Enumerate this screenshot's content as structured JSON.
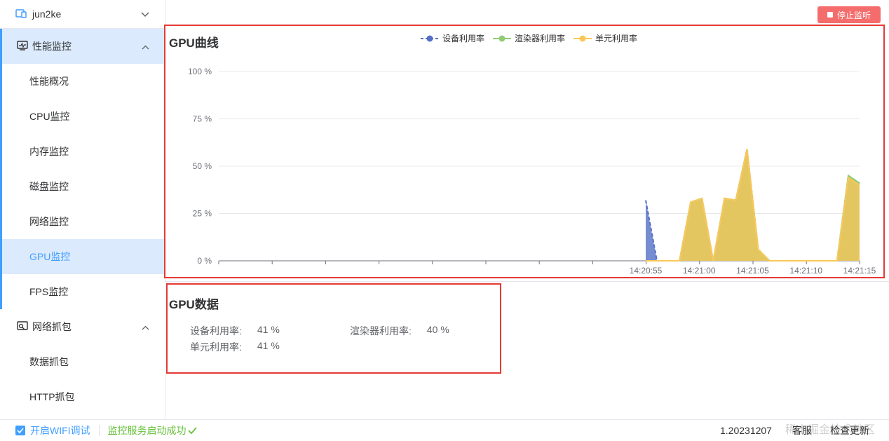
{
  "device": {
    "name": "jun2ke"
  },
  "sidebar": {
    "groups": [
      {
        "label": "性能监控",
        "items": [
          "性能概况",
          "CPU监控",
          "内存监控",
          "磁盘监控",
          "网络监控",
          "GPU监控",
          "FPS监控"
        ]
      },
      {
        "label": "网络抓包",
        "items": [
          "数据抓包",
          "HTTP抓包"
        ]
      }
    ],
    "active_item": "GPU监控"
  },
  "toolbar": {
    "stop_label": "停止监听"
  },
  "chart_panel": {
    "title": "GPU曲线"
  },
  "chart_data": {
    "type": "area",
    "title": "GPU曲线",
    "x_ticks": [
      "14:20:55",
      "14:21:00",
      "14:21:05",
      "14:21:10",
      "14:21:15"
    ],
    "y_ticks": [
      "0 %",
      "25 %",
      "50 %",
      "75 %",
      "100 %"
    ],
    "ylim": [
      0,
      100
    ],
    "unit": "%",
    "series": [
      {
        "name": "设备利用率",
        "color": "#5470c6",
        "values": [
          32,
          0,
          0,
          0,
          31,
          33,
          0,
          33,
          32,
          59,
          6,
          0,
          0,
          0,
          0,
          0,
          0,
          0,
          45,
          41
        ]
      },
      {
        "name": "渲染器利用率",
        "color": "#91cc75",
        "values": [
          0,
          0,
          0,
          0,
          31,
          33,
          0,
          33,
          32,
          59,
          6,
          0,
          0,
          0,
          0,
          0,
          0,
          0,
          45,
          41
        ]
      },
      {
        "name": "单元利用率",
        "color": "#fac858",
        "values": [
          0,
          0,
          0,
          0,
          31,
          33,
          0,
          33,
          32,
          59,
          6,
          0,
          0,
          0,
          0,
          0,
          0,
          0,
          44,
          40
        ]
      }
    ]
  },
  "data_panel": {
    "title": "GPU数据",
    "device_label": "设备利用率:",
    "device_value": "41 %",
    "renderer_label": "渲染器利用率:",
    "renderer_value": "40 %",
    "unit_label": "单元利用率:",
    "unit_value": "41 %"
  },
  "footer": {
    "wifi_label": "开启WIFI调试",
    "service_status": "监控服务启动成功",
    "version": "1.20231207",
    "support": "客服",
    "update": "检查更新",
    "watermark": "稀土掘金技术社区"
  },
  "colors": {
    "accent": "#409eff",
    "danger": "#f56c6c",
    "success": "#67c23a",
    "highlight_border": "#e53935"
  }
}
